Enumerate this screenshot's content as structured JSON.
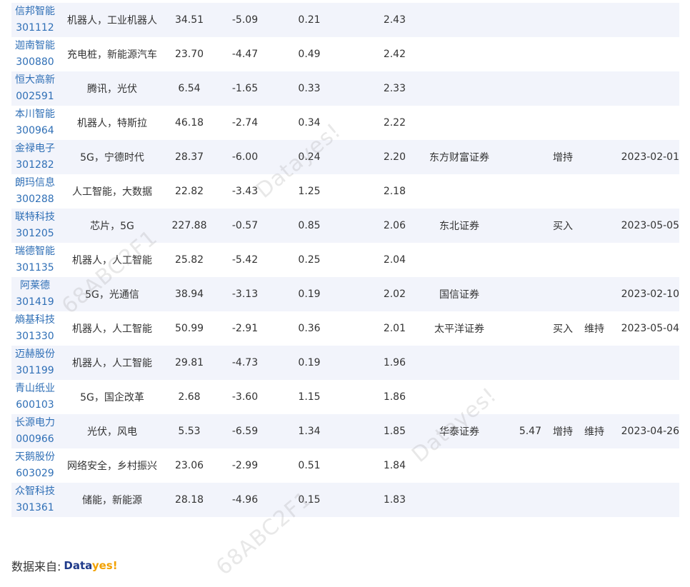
{
  "rows": [
    {
      "name": "信邦智能",
      "code": "301112",
      "concept": "机器人，工业机器人",
      "price": "34.51",
      "change_pct": "-5.09",
      "turnover": "0.21",
      "ratio": "2.43",
      "broker": "",
      "target": "",
      "rating": "",
      "rating_change": "",
      "date": ""
    },
    {
      "name": "迦南智能",
      "code": "300880",
      "concept": "充电桩，新能源汽车",
      "price": "23.70",
      "change_pct": "-4.47",
      "turnover": "0.49",
      "ratio": "2.42",
      "broker": "",
      "target": "",
      "rating": "",
      "rating_change": "",
      "date": ""
    },
    {
      "name": "恒大高新",
      "code": "002591",
      "concept": "腾讯，光伏",
      "price": "6.54",
      "change_pct": "-1.65",
      "turnover": "0.33",
      "ratio": "2.33",
      "broker": "",
      "target": "",
      "rating": "",
      "rating_change": "",
      "date": ""
    },
    {
      "name": "本川智能",
      "code": "300964",
      "concept": "机器人，特斯拉",
      "price": "46.18",
      "change_pct": "-2.74",
      "turnover": "0.34",
      "ratio": "2.22",
      "broker": "",
      "target": "",
      "rating": "",
      "rating_change": "",
      "date": ""
    },
    {
      "name": "金禄电子",
      "code": "301282",
      "concept": "5G，宁德时代",
      "price": "28.37",
      "change_pct": "-6.00",
      "turnover": "0.24",
      "ratio": "2.20",
      "broker": "东方财富证券",
      "target": "",
      "rating": "增持",
      "rating_change": "",
      "date": "2023-02-01"
    },
    {
      "name": "朗玛信息",
      "code": "300288",
      "concept": "人工智能，大数据",
      "price": "22.82",
      "change_pct": "-3.43",
      "turnover": "1.25",
      "ratio": "2.18",
      "broker": "",
      "target": "",
      "rating": "",
      "rating_change": "",
      "date": ""
    },
    {
      "name": "联特科技",
      "code": "301205",
      "concept": "芯片，5G",
      "price": "227.88",
      "change_pct": "-0.57",
      "turnover": "0.85",
      "ratio": "2.06",
      "broker": "东北证券",
      "target": "",
      "rating": "买入",
      "rating_change": "",
      "date": "2023-05-05"
    },
    {
      "name": "瑞德智能",
      "code": "301135",
      "concept": "机器人，人工智能",
      "price": "25.82",
      "change_pct": "-5.42",
      "turnover": "0.25",
      "ratio": "2.04",
      "broker": "",
      "target": "",
      "rating": "",
      "rating_change": "",
      "date": ""
    },
    {
      "name": "阿莱德",
      "code": "301419",
      "concept": "5G，光通信",
      "price": "38.94",
      "change_pct": "-3.13",
      "turnover": "0.19",
      "ratio": "2.02",
      "broker": "国信证券",
      "target": "",
      "rating": "",
      "rating_change": "",
      "date": "2023-02-10"
    },
    {
      "name": "熵基科技",
      "code": "301330",
      "concept": "机器人，人工智能",
      "price": "50.99",
      "change_pct": "-2.91",
      "turnover": "0.36",
      "ratio": "2.01",
      "broker": "太平洋证券",
      "target": "",
      "rating": "买入",
      "rating_change": "维持",
      "date": "2023-05-04"
    },
    {
      "name": "迈赫股份",
      "code": "301199",
      "concept": "机器人，人工智能",
      "price": "29.81",
      "change_pct": "-4.73",
      "turnover": "0.19",
      "ratio": "1.96",
      "broker": "",
      "target": "",
      "rating": "",
      "rating_change": "",
      "date": ""
    },
    {
      "name": "青山纸业",
      "code": "600103",
      "concept": "5G，国企改革",
      "price": "2.68",
      "change_pct": "-3.60",
      "turnover": "1.15",
      "ratio": "1.86",
      "broker": "",
      "target": "",
      "rating": "",
      "rating_change": "",
      "date": ""
    },
    {
      "name": "长源电力",
      "code": "000966",
      "concept": "光伏，风电",
      "price": "5.53",
      "change_pct": "-6.59",
      "turnover": "1.34",
      "ratio": "1.85",
      "broker": "华泰证券",
      "target": "5.47",
      "rating": "增持",
      "rating_change": "维持",
      "date": "2023-04-26"
    },
    {
      "name": "天鹅股份",
      "code": "603029",
      "concept": "网络安全，乡村振兴",
      "price": "23.06",
      "change_pct": "-2.99",
      "turnover": "0.51",
      "ratio": "1.84",
      "broker": "",
      "target": "",
      "rating": "",
      "rating_change": "",
      "date": ""
    },
    {
      "name": "众智科技",
      "code": "301361",
      "concept": "储能，新能源",
      "price": "28.18",
      "change_pct": "-4.96",
      "turnover": "0.15",
      "ratio": "1.83",
      "broker": "",
      "target": "",
      "rating": "",
      "rating_change": "",
      "date": ""
    }
  ],
  "watermark": {
    "brand": "Datayes!",
    "id": "68ABC2F1"
  },
  "footer": {
    "source_label": "数据来自:",
    "logo_part1": "Data",
    "logo_part2": "yes!"
  }
}
